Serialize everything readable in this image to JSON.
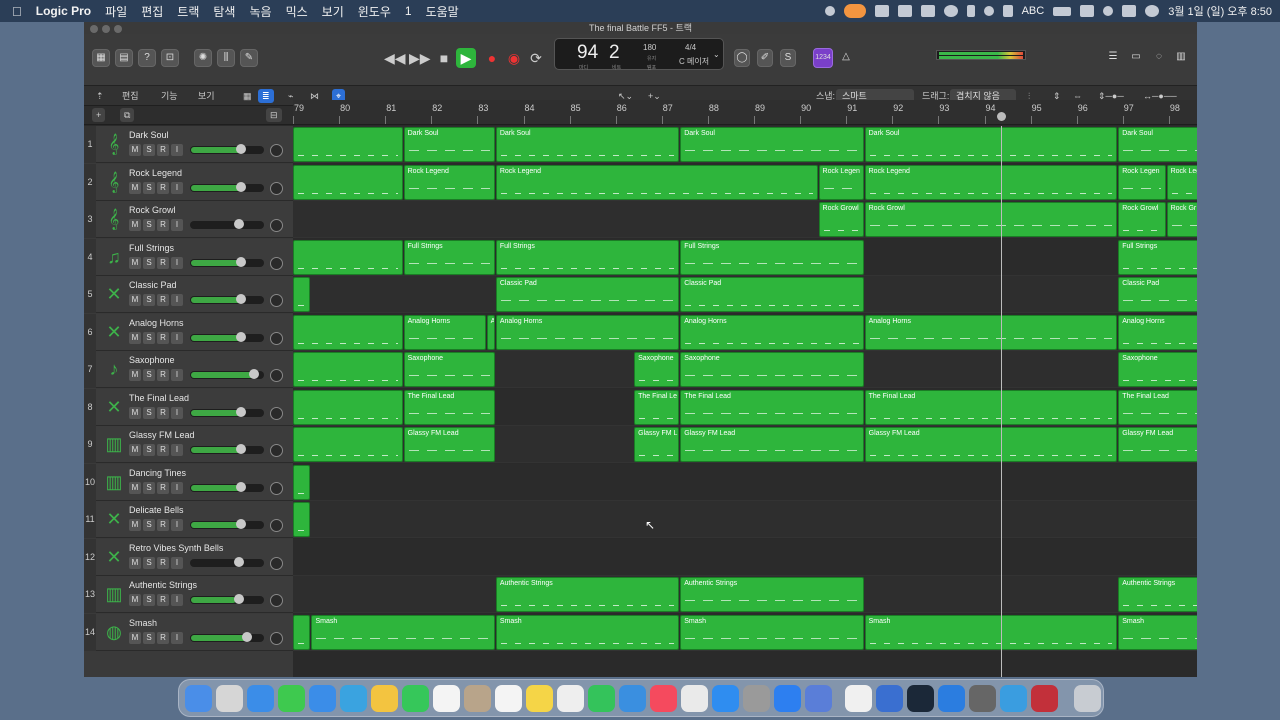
{
  "menubar": {
    "app": "Logic Pro",
    "items": [
      "파일",
      "편집",
      "트랙",
      "탐색",
      "녹음",
      "믹스",
      "보기",
      "윈도우",
      "1",
      "도움말"
    ],
    "input": "ABC",
    "datetime": "3월 1일 (일) 오후 8:50"
  },
  "window": {
    "title": "The final Battle FF5 - 트랙"
  },
  "lcd": {
    "bar": "94",
    "beat": "2",
    "bar_label": "마디",
    "beat_label": "비트",
    "tempo": "180",
    "tempo_sub": "유지",
    "tempo_label": "템포",
    "signature": "4/4",
    "key": "C 메이저"
  },
  "counter_badge": "1234",
  "toolbar2": {
    "edit": "편집",
    "func": "기능",
    "view": "보기",
    "snap_label": "스냅:",
    "snap_value": "스마트",
    "drag_label": "드래그:",
    "drag_value": "겹치지 않음"
  },
  "ruler": {
    "bars": [
      "79",
      "80",
      "81",
      "82",
      "83",
      "84",
      "85",
      "86",
      "87",
      "88",
      "89",
      "90",
      "91",
      "92",
      "93",
      "94",
      "95",
      "96",
      "97",
      "98"
    ]
  },
  "tracks": [
    {
      "num": "1",
      "name": "Dark Soul",
      "icon": "guitar-icon"
    },
    {
      "num": "2",
      "name": "Rock Legend",
      "icon": "guitar-icon"
    },
    {
      "num": "3",
      "name": "Rock Growl",
      "icon": "guitar-icon"
    },
    {
      "num": "4",
      "name": "Full Strings",
      "icon": "violin-icon"
    },
    {
      "num": "5",
      "name": "Classic Pad",
      "icon": "synth-icon"
    },
    {
      "num": "6",
      "name": "Analog Horns",
      "icon": "synth-icon"
    },
    {
      "num": "7",
      "name": "Saxophone",
      "icon": "saxophone-icon"
    },
    {
      "num": "8",
      "name": "The Final Lead",
      "icon": "synth-icon"
    },
    {
      "num": "9",
      "name": "Glassy FM Lead",
      "icon": "keyboard-icon"
    },
    {
      "num": "10",
      "name": "Dancing Tines",
      "icon": "keyboard-icon"
    },
    {
      "num": "11",
      "name": "Delicate Bells",
      "icon": "synth-icon"
    },
    {
      "num": "12",
      "name": "Retro Vibes Synth Bells",
      "icon": "synth-icon"
    },
    {
      "num": "13",
      "name": "Authentic Strings",
      "icon": "keyboard-icon"
    },
    {
      "num": "14",
      "name": "Smash",
      "icon": "drums-icon"
    }
  ],
  "msri": {
    "m": "M",
    "s": "S",
    "r": "R",
    "i": "I"
  },
  "regions": [
    [
      {
        "s": 79,
        "e": 81.4,
        "l": ""
      },
      {
        "s": 81.4,
        "e": 83.4,
        "l": "Dark Soul"
      },
      {
        "s": 83.4,
        "e": 87.4,
        "l": "Dark Soul"
      },
      {
        "s": 87.4,
        "e": 91.4,
        "l": "Dark Soul"
      },
      {
        "s": 91.4,
        "e": 96.9,
        "l": "Dark Soul"
      },
      {
        "s": 96.9,
        "e": 99,
        "l": "Dark Soul"
      }
    ],
    [
      {
        "s": 79,
        "e": 81.4,
        "l": ""
      },
      {
        "s": 81.4,
        "e": 83.4,
        "l": "Rock Legend"
      },
      {
        "s": 83.4,
        "e": 90.4,
        "l": "Rock Legend"
      },
      {
        "s": 90.4,
        "e": 91.4,
        "l": "Rock Legen"
      },
      {
        "s": 91.4,
        "e": 96.9,
        "l": "Rock Legend"
      },
      {
        "s": 96.9,
        "e": 97.95,
        "l": "Rock Legen"
      },
      {
        "s": 97.95,
        "e": 99,
        "l": "Rock Leg"
      }
    ],
    [
      {
        "s": 90.4,
        "e": 91.4,
        "l": "Rock Growl"
      },
      {
        "s": 91.4,
        "e": 96.9,
        "l": "Rock Growl"
      },
      {
        "s": 96.9,
        "e": 97.95,
        "l": "Rock Growl"
      },
      {
        "s": 97.95,
        "e": 99,
        "l": "Rock Gr"
      }
    ],
    [
      {
        "s": 79,
        "e": 81.4,
        "l": ""
      },
      {
        "s": 81.4,
        "e": 83.4,
        "l": "Full Strings"
      },
      {
        "s": 83.4,
        "e": 87.4,
        "l": "Full Strings"
      },
      {
        "s": 87.4,
        "e": 91.4,
        "l": "Full Strings"
      },
      {
        "s": 96.9,
        "e": 99,
        "l": "Full Strings"
      }
    ],
    [
      {
        "s": 79,
        "e": 79.4,
        "l": ""
      },
      {
        "s": 83.4,
        "e": 87.4,
        "l": "Classic Pad"
      },
      {
        "s": 87.4,
        "e": 91.4,
        "l": "Classic Pad"
      },
      {
        "s": 96.9,
        "e": 99,
        "l": "Classic Pad"
      }
    ],
    [
      {
        "s": 79,
        "e": 81.4,
        "l": ""
      },
      {
        "s": 81.4,
        "e": 83.2,
        "l": "Analog Horns"
      },
      {
        "s": 83.2,
        "e": 83.4,
        "l": "A"
      },
      {
        "s": 83.4,
        "e": 87.4,
        "l": "Analog Horns"
      },
      {
        "s": 87.4,
        "e": 91.4,
        "l": "Analog Horns"
      },
      {
        "s": 91.4,
        "e": 96.9,
        "l": "Analog Horns"
      },
      {
        "s": 96.9,
        "e": 99,
        "l": "Analog Horns"
      }
    ],
    [
      {
        "s": 79,
        "e": 81.4,
        "l": ""
      },
      {
        "s": 81.4,
        "e": 83.4,
        "l": "Saxophone"
      },
      {
        "s": 86.4,
        "e": 87.4,
        "l": "Saxophone"
      },
      {
        "s": 87.4,
        "e": 91.4,
        "l": "Saxophone"
      },
      {
        "s": 96.9,
        "e": 99,
        "l": "Saxophone"
      }
    ],
    [
      {
        "s": 79,
        "e": 81.4,
        "l": ""
      },
      {
        "s": 81.4,
        "e": 83.4,
        "l": "The Final Lead"
      },
      {
        "s": 86.4,
        "e": 87.4,
        "l": "The Final Le"
      },
      {
        "s": 87.4,
        "e": 91.4,
        "l": "The Final Lead"
      },
      {
        "s": 91.4,
        "e": 96.9,
        "l": "The Final Lead"
      },
      {
        "s": 96.9,
        "e": 99,
        "l": "The Final Lead"
      }
    ],
    [
      {
        "s": 79,
        "e": 81.4,
        "l": ""
      },
      {
        "s": 81.4,
        "e": 83.4,
        "l": "Glassy FM Lead"
      },
      {
        "s": 86.4,
        "e": 87.4,
        "l": "Glassy FM L"
      },
      {
        "s": 87.4,
        "e": 91.4,
        "l": "Glassy FM Lead"
      },
      {
        "s": 91.4,
        "e": 96.9,
        "l": "Glassy FM Lead"
      },
      {
        "s": 96.9,
        "e": 99,
        "l": "Glassy FM Lead"
      }
    ],
    [
      {
        "s": 79,
        "e": 79.4,
        "l": ""
      }
    ],
    [
      {
        "s": 79,
        "e": 79.4,
        "l": ""
      }
    ],
    [],
    [
      {
        "s": 83.4,
        "e": 87.4,
        "l": "Authentic Strings"
      },
      {
        "s": 87.4,
        "e": 91.4,
        "l": "Authentic Strings"
      },
      {
        "s": 96.9,
        "e": 99,
        "l": "Authentic Strings"
      }
    ],
    [
      {
        "s": 79,
        "e": 79.4,
        "l": ""
      },
      {
        "s": 79.4,
        "e": 83.4,
        "l": "Smash"
      },
      {
        "s": 83.4,
        "e": 87.4,
        "l": "Smash"
      },
      {
        "s": 87.4,
        "e": 91.4,
        "l": "Smash"
      },
      {
        "s": 91.4,
        "e": 96.9,
        "l": "Smash"
      },
      {
        "s": 96.9,
        "e": 99,
        "l": "Smash"
      }
    ]
  ],
  "playhead_bar": 94.35,
  "volumes": [
    0.72,
    0.72,
    0,
    0.72,
    0.72,
    0.72,
    0.9,
    0.72,
    0.72,
    0.72,
    0.72,
    0,
    0.64,
    0.8
  ],
  "accent": "#2eb53c"
}
